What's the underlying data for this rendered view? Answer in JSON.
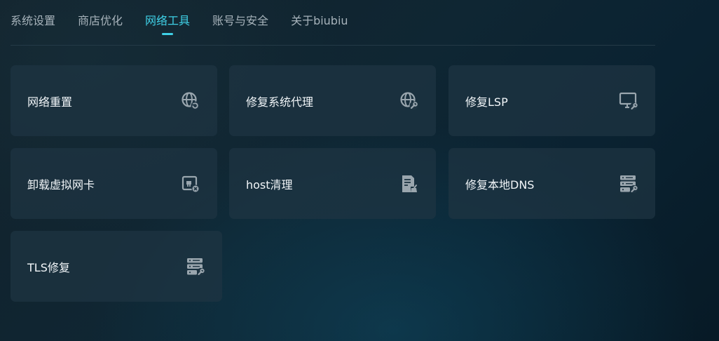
{
  "tabs": [
    {
      "label": "系统设置"
    },
    {
      "label": "商店优化"
    },
    {
      "label": "网络工具"
    },
    {
      "label": "账号与安全"
    },
    {
      "label": "关于biubiu"
    }
  ],
  "active_tab": "网络工具",
  "accent_color": "#3fd0e6",
  "cards": [
    {
      "label": "网络重置",
      "icon": "globe-refresh-icon"
    },
    {
      "label": "修复系统代理",
      "icon": "globe-wrench-icon"
    },
    {
      "label": "修复LSP",
      "icon": "monitor-wrench-icon"
    },
    {
      "label": "卸载虚拟网卡",
      "icon": "network-card-remove-icon"
    },
    {
      "label": "host清理",
      "icon": "document-broom-icon"
    },
    {
      "label": "修复本地DNS",
      "icon": "server-wrench-icon"
    },
    {
      "label": "TLS修复",
      "icon": "server-wrench-icon"
    }
  ]
}
